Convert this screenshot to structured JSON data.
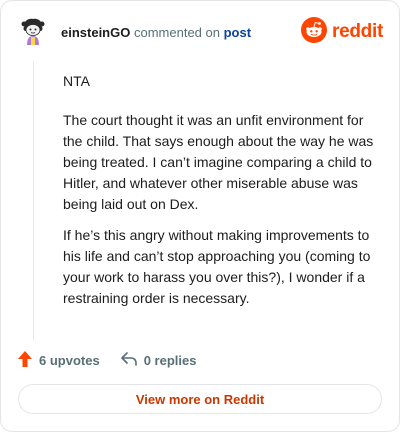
{
  "header": {
    "username": "einsteinGO",
    "commented_text": "commented on",
    "post_link": "post",
    "logo_text": "reddit",
    "avatar_icon": "snoo-avatar-icon",
    "logo_icon": "reddit-alien-icon"
  },
  "comment": {
    "paragraphs": [
      "NTA",
      "The court thought it was an unfit environment for the child. That says enough about the way he was being treated. I can’t imagine comparing a child to Hitler, and whatever other miserable abuse was being laid out on Dex.",
      "If he’s this angry without making improvements to his life and can’t stop approaching you (coming to your work to harass you over this?), I wonder if a restraining order is necessary."
    ]
  },
  "actions": {
    "upvotes": "6 upvotes",
    "replies": "0 replies",
    "upvote_icon": "upvote-arrow-icon",
    "reply_icon": "reply-arrow-icon"
  },
  "view_more": "View more on Reddit",
  "colors": {
    "brand": "#ff4500",
    "link": "#0a449b",
    "muted": "#576f76",
    "view_more": "#cc3700"
  }
}
